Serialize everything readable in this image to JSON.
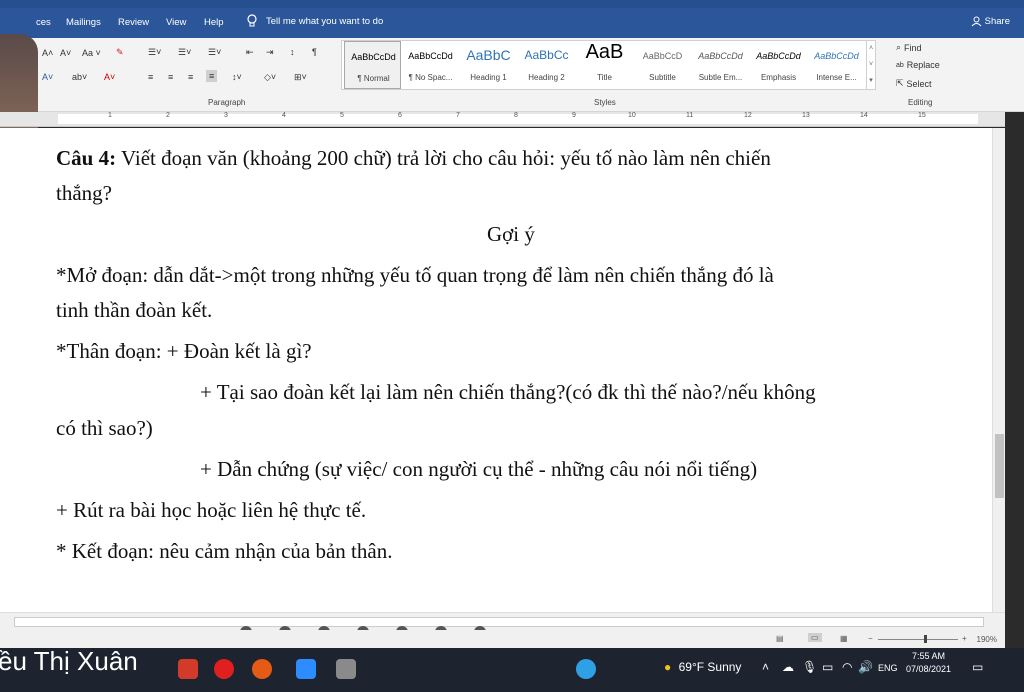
{
  "menu": {
    "items": [
      "ces",
      "Mailings",
      "Review",
      "View",
      "Help"
    ],
    "tell_me": "Tell me what you want to do",
    "share": "Share"
  },
  "ribbon": {
    "paragraph_label": "Paragraph",
    "styles_label": "Styles",
    "editing_label": "Editing",
    "styles": [
      {
        "preview": "AaBbCcDd",
        "name": "¶ Normal"
      },
      {
        "preview": "AaBbCcDd",
        "name": "¶ No Spac..."
      },
      {
        "preview": "AaBbC",
        "name": "Heading 1"
      },
      {
        "preview": "AaBbCc",
        "name": "Heading 2"
      },
      {
        "preview": "AaB",
        "name": "Title"
      },
      {
        "preview": "AaBbCcD",
        "name": "Subtitle"
      },
      {
        "preview": "AaBbCcDd",
        "name": "Subtle Em..."
      },
      {
        "preview": "AaBbCcDd",
        "name": "Emphasis"
      },
      {
        "preview": "AaBbCcDd",
        "name": "Intense E..."
      }
    ],
    "find": "Find",
    "replace": "Replace",
    "select": "Select"
  },
  "ruler": {
    "numbers": [
      "1",
      "2",
      "3",
      "4",
      "5",
      "6",
      "7",
      "8",
      "9",
      "10",
      "11",
      "12",
      "13",
      "14",
      "15"
    ]
  },
  "document": {
    "q4_bold": "Câu 4:",
    "q4_text": " Viết đoạn văn (khoảng 200 chữ) trả lời cho câu hỏi: yếu tố nào làm nên chiến",
    "q4_cont": "thắng?",
    "hint_title": "Gợi ý",
    "open_1": "*Mở đoạn: dẫn dắt->một trong những yếu tố quan trọng để làm nên chiến thắng đó là",
    "open_2": "tinh thần đoàn kết.",
    "body_1": "*Thân đoạn:  + Đoàn kết là gì?",
    "body_2": "+ Tại sao đoàn kết lại làm nên chiến thắng?(có đk thì thế nào?/nếu không",
    "body_3": "có thì sao?)",
    "body_4": "+ Dẫn chứng (sự việc/ con người cụ thể - những câu nói nổi tiếng)",
    "body_5": "+ Rút ra bài học hoặc liên hệ thực tế.",
    "close": "* Kết đoạn: nêu cảm nhận của bản thân."
  },
  "status": {
    "zoom": "190%"
  },
  "taskbar": {
    "caption_name": "ều Thị Xuân",
    "weather": "69°F  Sunny",
    "lang": "ENG",
    "time": "7:55 AM",
    "date": "07/08/2021"
  }
}
